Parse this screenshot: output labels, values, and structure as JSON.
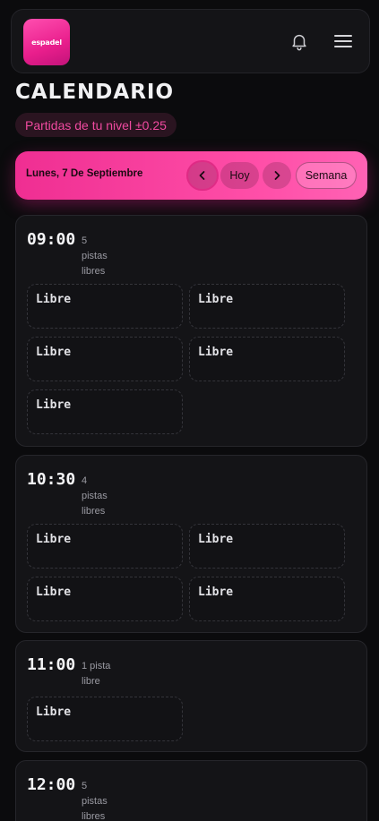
{
  "header": {
    "logo_text": "espadel",
    "icons": {
      "notifications": "bell-icon",
      "menu": "hamburger-icon"
    }
  },
  "page": {
    "title": "CALENDARIO",
    "level_filter": "Partidas de tu nivel ±0.25"
  },
  "date_nav": {
    "date_label": "Lunes, 7 De Septiembre",
    "today_label": "Hoy",
    "week_label": "Semana",
    "prev_icon": "chevron-left-icon",
    "next_icon": "chevron-right-icon"
  },
  "slots": [
    {
      "time": "09:00",
      "count": "5",
      "count_text_1": "pistas",
      "count_text_2": "libres",
      "courts": [
        "Libre",
        "Libre",
        "Libre",
        "Libre",
        "Libre"
      ]
    },
    {
      "time": "10:30",
      "count": "4",
      "count_text_1": "pistas",
      "count_text_2": "libres",
      "courts": [
        "Libre",
        "Libre",
        "Libre",
        "Libre"
      ]
    },
    {
      "time": "11:00",
      "count": "1 pista",
      "count_text_1": "libre",
      "courts": [
        "Libre"
      ]
    },
    {
      "time": "12:00",
      "count": "5",
      "count_text_1": "pistas",
      "count_text_2": "libres",
      "courts": []
    }
  ],
  "colors": {
    "accent": "#ef2e92",
    "background": "#0b0b0d",
    "card": "#141417"
  }
}
